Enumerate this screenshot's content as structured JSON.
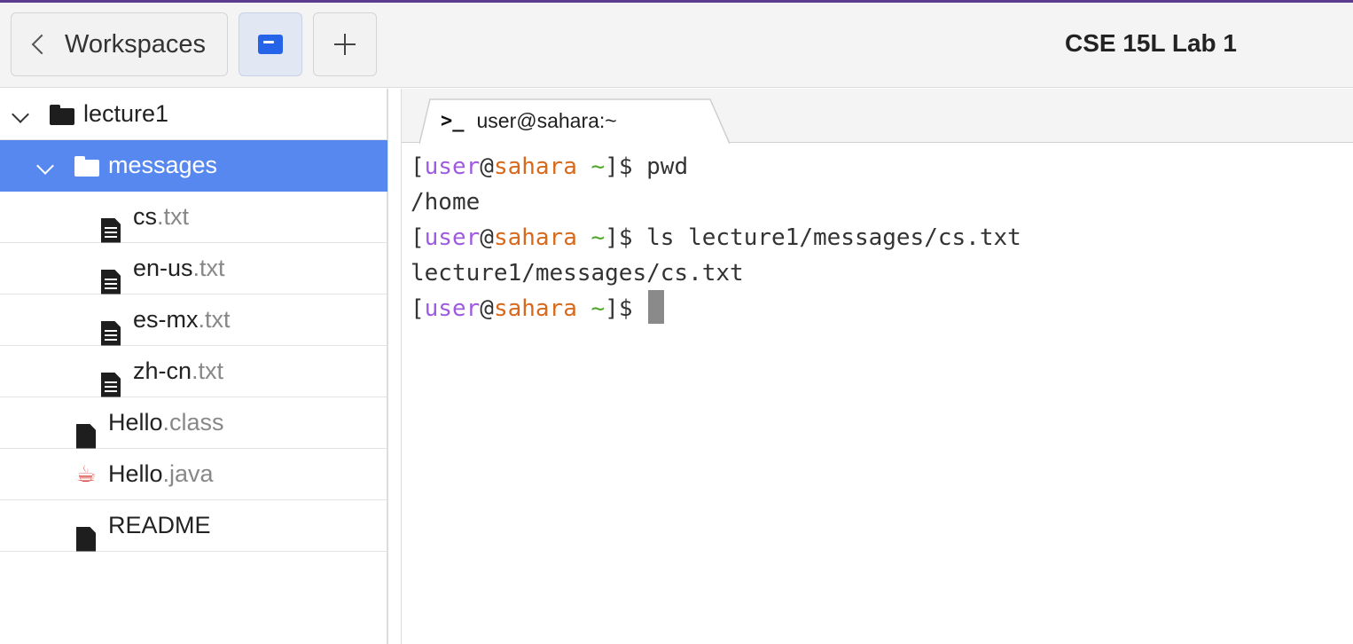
{
  "toolbar": {
    "workspaces_label": "Workspaces",
    "title": "CSE 15L Lab 1"
  },
  "sidebar": {
    "root": {
      "name": "lecture1"
    },
    "folder": {
      "name": "messages"
    },
    "files": [
      {
        "base": "cs",
        "ext": ".txt"
      },
      {
        "base": "en-us",
        "ext": ".txt"
      },
      {
        "base": "es-mx",
        "ext": ".txt"
      },
      {
        "base": "zh-cn",
        "ext": ".txt"
      }
    ],
    "root_files": [
      {
        "base": "Hello",
        "ext": ".class"
      },
      {
        "base": "Hello",
        "ext": ".java"
      },
      {
        "base": "README",
        "ext": ""
      }
    ]
  },
  "terminal": {
    "tab_label": "user@sahara:~",
    "prompt": {
      "open": "[",
      "user": "user",
      "at": "@",
      "host": "sahara",
      "dir": "~",
      "close": "]$ "
    },
    "lines": [
      {
        "type": "command",
        "text": "pwd"
      },
      {
        "type": "output",
        "text": "/home"
      },
      {
        "type": "command",
        "text": "ls lecture1/messages/cs.txt"
      },
      {
        "type": "output",
        "text": "lecture1/messages/cs.txt"
      },
      {
        "type": "command",
        "text": ""
      }
    ]
  },
  "colors": {
    "accent": "#5b3c8f",
    "selection": "#5688f0",
    "prompt_user": "#a05ae0",
    "prompt_host": "#d8691b",
    "prompt_dir": "#52a630"
  }
}
